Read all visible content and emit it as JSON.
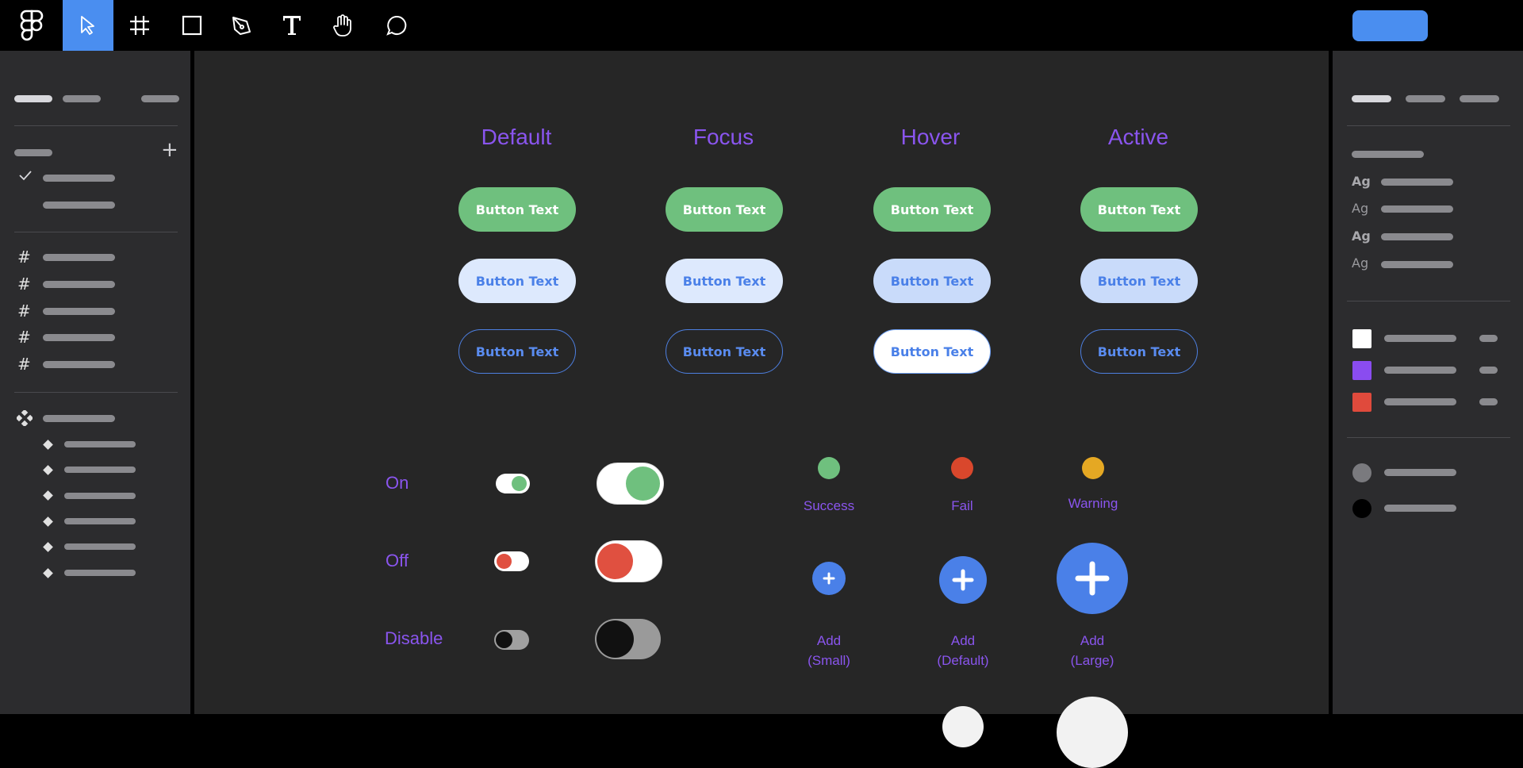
{
  "toolbar": {
    "tools": [
      {
        "name": "figma-logo-icon"
      },
      {
        "name": "move-tool-icon",
        "active": true
      },
      {
        "name": "frame-tool-icon"
      },
      {
        "name": "rectangle-tool-icon"
      },
      {
        "name": "pen-tool-icon"
      },
      {
        "name": "text-tool-icon"
      },
      {
        "name": "hand-tool-icon"
      },
      {
        "name": "comment-tool-icon"
      }
    ],
    "share_color": "#4a8ef0"
  },
  "canvas": {
    "columns": [
      "Default",
      "Focus",
      "Hover",
      "Active"
    ],
    "button_label": "Button Text",
    "toggles": {
      "rows": [
        "On",
        "Off",
        "Disable"
      ]
    },
    "status": [
      {
        "label": "Success",
        "color": "#6fc07e"
      },
      {
        "label": "Fail",
        "color": "#d9472c"
      },
      {
        "label": "Warning",
        "color": "#e5a823"
      }
    ],
    "add_buttons": [
      {
        "line1": "Add",
        "line2": "(Small)"
      },
      {
        "line1": "Add",
        "line2": "(Default)"
      },
      {
        "line1": "Add",
        "line2": "(Large)"
      }
    ]
  },
  "colors": {
    "accent_purple": "#8a55ee",
    "primary_green": "#6fc07e",
    "blue": "#4a80e8",
    "red": "#e05040"
  },
  "right_panel": {
    "type_samples": [
      "Ag",
      "Ag",
      "Ag",
      "Ag"
    ],
    "swatches": [
      "#ffffff",
      "#8a4cf0",
      "#e04a3c"
    ],
    "circle_swatches": [
      "#7a7a7e",
      "#000000"
    ]
  }
}
